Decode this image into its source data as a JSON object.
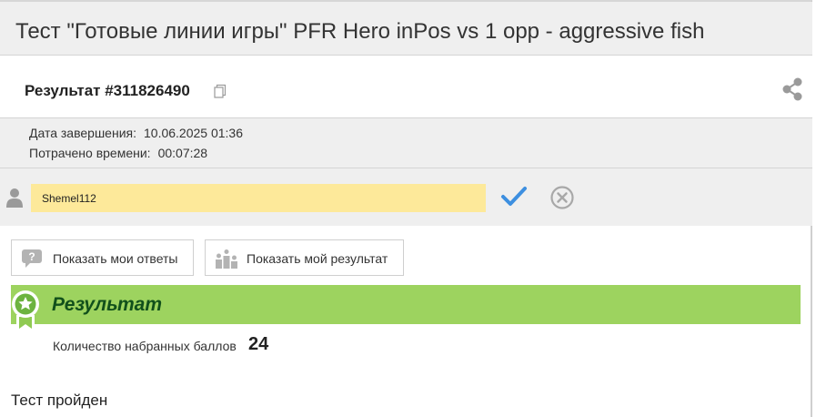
{
  "title": "Тест \"Готовые линии игры\" PFR Hero inPos vs 1 opp - aggressive fish",
  "result": {
    "label": "Результат #311826490",
    "copy_icon": "copy-icon",
    "share_icon": "share-icon"
  },
  "meta": {
    "completion_label": "Дата завершения:",
    "completion_value": "10.06.2025 01:36",
    "time_label": "Потрачено времени:",
    "time_value": "00:07:28"
  },
  "user": {
    "icon": "user-icon",
    "name_value": "Shemel112",
    "confirm_icon": "checkmark-icon",
    "cancel_icon": "cancel-circle-icon"
  },
  "buttons": {
    "show_answers": "Показать мои ответы",
    "show_result": "Показать мой результат"
  },
  "banner": {
    "title": "Результат",
    "badge_icon": "award-ribbon-icon"
  },
  "score": {
    "label": "Количество набранных баллов",
    "value": "24"
  },
  "status": "Тест пройден",
  "colors": {
    "banner_bg": "#9dd35f",
    "banner_text": "#11501b",
    "input_bg": "#fde99a",
    "check": "#3d8fe0",
    "panel_bg": "#efefef"
  }
}
